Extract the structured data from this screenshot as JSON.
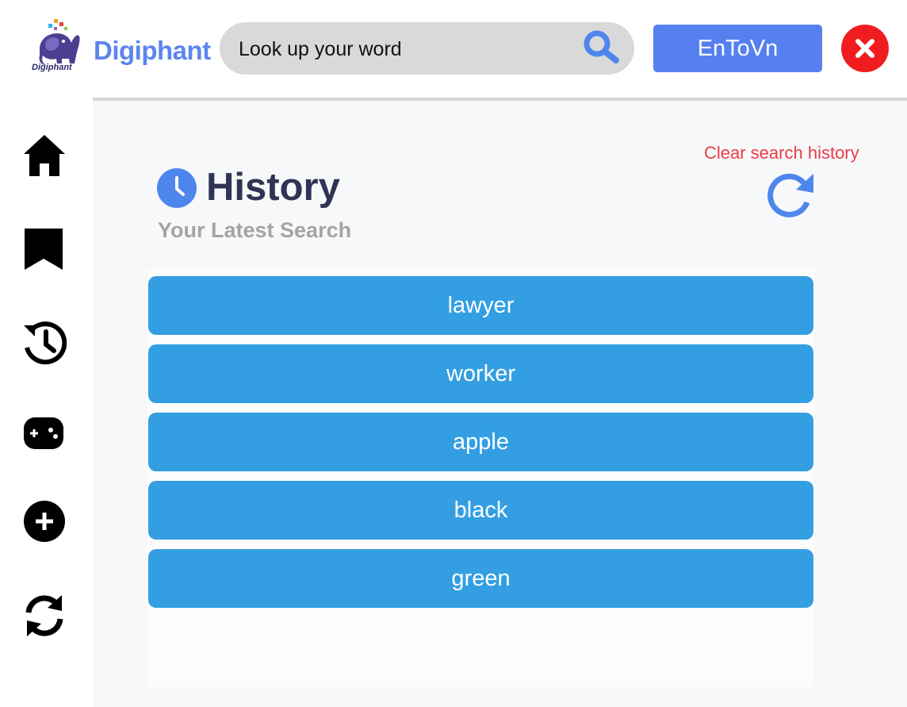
{
  "header": {
    "brand_name": "Digiphant",
    "logo_caption": "Digiphant",
    "search": {
      "placeholder": "Look up your word",
      "value": ""
    },
    "language_button_label": "EnToVn"
  },
  "sidebar": {
    "items": [
      {
        "icon": "home-icon"
      },
      {
        "icon": "bookmark-icon"
      },
      {
        "icon": "history-icon"
      },
      {
        "icon": "gamepad-icon"
      },
      {
        "icon": "plus-circle-icon"
      },
      {
        "icon": "sync-icon"
      }
    ]
  },
  "main": {
    "title": "History",
    "subtitle": "Your Latest Search",
    "clear_label": "Clear search history",
    "history_items": [
      {
        "word": "lawyer"
      },
      {
        "word": "worker"
      },
      {
        "word": "apple"
      },
      {
        "word": "black"
      },
      {
        "word": "green"
      }
    ]
  },
  "colors": {
    "brand_blue": "#5b86ef",
    "button_blue": "#5680f0",
    "item_blue": "#339fe2",
    "title_navy": "#2f3354",
    "clear_red": "#ee3b46",
    "close_red": "#f01c1f"
  }
}
